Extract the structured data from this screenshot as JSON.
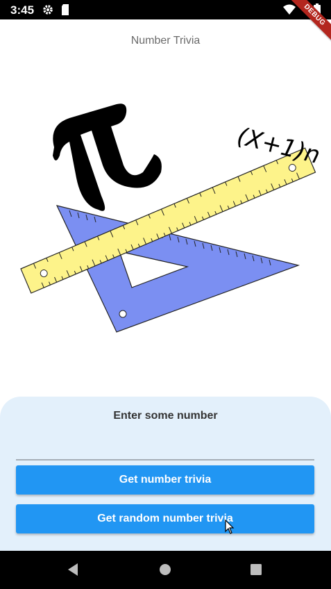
{
  "status_bar": {
    "time": "3:45",
    "icons": [
      "gear-icon",
      "sd-card-icon",
      "wifi-icon",
      "battery-icon"
    ]
  },
  "debug_banner": "DEBUG",
  "app": {
    "title": "Number Trivia"
  },
  "illustration": {
    "formula": "(X+1)n",
    "pi_symbol": "π"
  },
  "panel": {
    "label": "Enter some number",
    "input_value": "",
    "input_placeholder": "",
    "get_trivia_label": "Get number trivia",
    "get_random_label": "Get random number trivia"
  },
  "colors": {
    "primary": "#2196f3",
    "panel_bg": "#e3f0fb",
    "ruler": "#fdf38a",
    "triangle": "#7b8ff2"
  },
  "nav_bar": {
    "icons": [
      "back-icon",
      "home-icon",
      "recents-icon"
    ]
  }
}
